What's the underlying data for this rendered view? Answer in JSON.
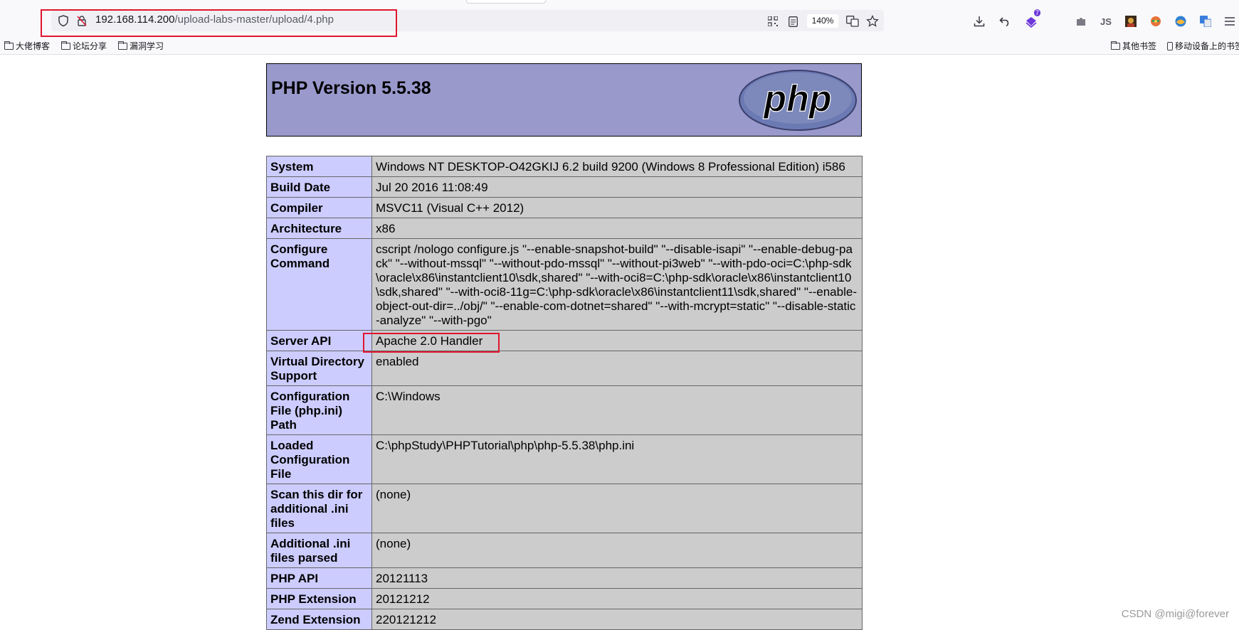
{
  "browser": {
    "url_host": "192.168.114.200",
    "url_path": "/upload-labs-master/upload/4.php",
    "zoom": "140%",
    "notification_count": "7",
    "icons": [
      "shield-icon",
      "lock-crossed-icon",
      "qr-code-icon",
      "reader-mode-icon",
      "translate-icon",
      "star-icon",
      "download-icon",
      "undo-icon",
      "extension-icon",
      "puzzle-icon",
      "js-icon",
      "avatar-icon",
      "colorful-extension-icon",
      "translate-extension-icon",
      "menu-icon"
    ],
    "bookmarks": [
      "大佬博客",
      "论坛分享",
      "漏洞学习"
    ],
    "other_bookmarks": "其他书签",
    "mobile_bookmarks": "移动设备上的书签"
  },
  "phpinfo": {
    "title": "PHP Version 5.5.38",
    "logo_text": "php",
    "rows": [
      {
        "key": "System",
        "value": "Windows NT DESKTOP-O42GKIJ 6.2 build 9200 (Windows 8 Professional Edition) i586"
      },
      {
        "key": "Build Date",
        "value": "Jul 20 2016 11:08:49"
      },
      {
        "key": "Compiler",
        "value": "MSVC11 (Visual C++ 2012)"
      },
      {
        "key": "Architecture",
        "value": "x86"
      },
      {
        "key": "Configure Command",
        "value": "cscript /nologo configure.js \"--enable-snapshot-build\" \"--disable-isapi\" \"--enable-debug-pack\" \"--without-mssql\" \"--without-pdo-mssql\" \"--without-pi3web\" \"--with-pdo-oci=C:\\php-sdk\\oracle\\x86\\instantclient10\\sdk,shared\" \"--with-oci8=C:\\php-sdk\\oracle\\x86\\instantclient10\\sdk,shared\" \"--with-oci8-11g=C:\\php-sdk\\oracle\\x86\\instantclient11\\sdk,shared\" \"--enable-object-out-dir=../obj/\" \"--enable-com-dotnet=shared\" \"--with-mcrypt=static\" \"--disable-static-analyze\" \"--with-pgo\""
      },
      {
        "key": "Server API",
        "value": "Apache 2.0 Handler"
      },
      {
        "key": "Virtual Directory Support",
        "value": "enabled"
      },
      {
        "key": "Configuration File (php.ini) Path",
        "value": "C:\\Windows"
      },
      {
        "key": "Loaded Configuration File",
        "value": "C:\\phpStudy\\PHPTutorial\\php\\php-5.5.38\\php.ini"
      },
      {
        "key": "Scan this dir for additional .ini files",
        "value": "(none)"
      },
      {
        "key": "Additional .ini files parsed",
        "value": "(none)"
      },
      {
        "key": "PHP API",
        "value": "20121113"
      },
      {
        "key": "PHP Extension",
        "value": "20121212"
      },
      {
        "key": "Zend Extension",
        "value": "220121212"
      }
    ]
  },
  "watermark": "CSDN @migi@forever"
}
